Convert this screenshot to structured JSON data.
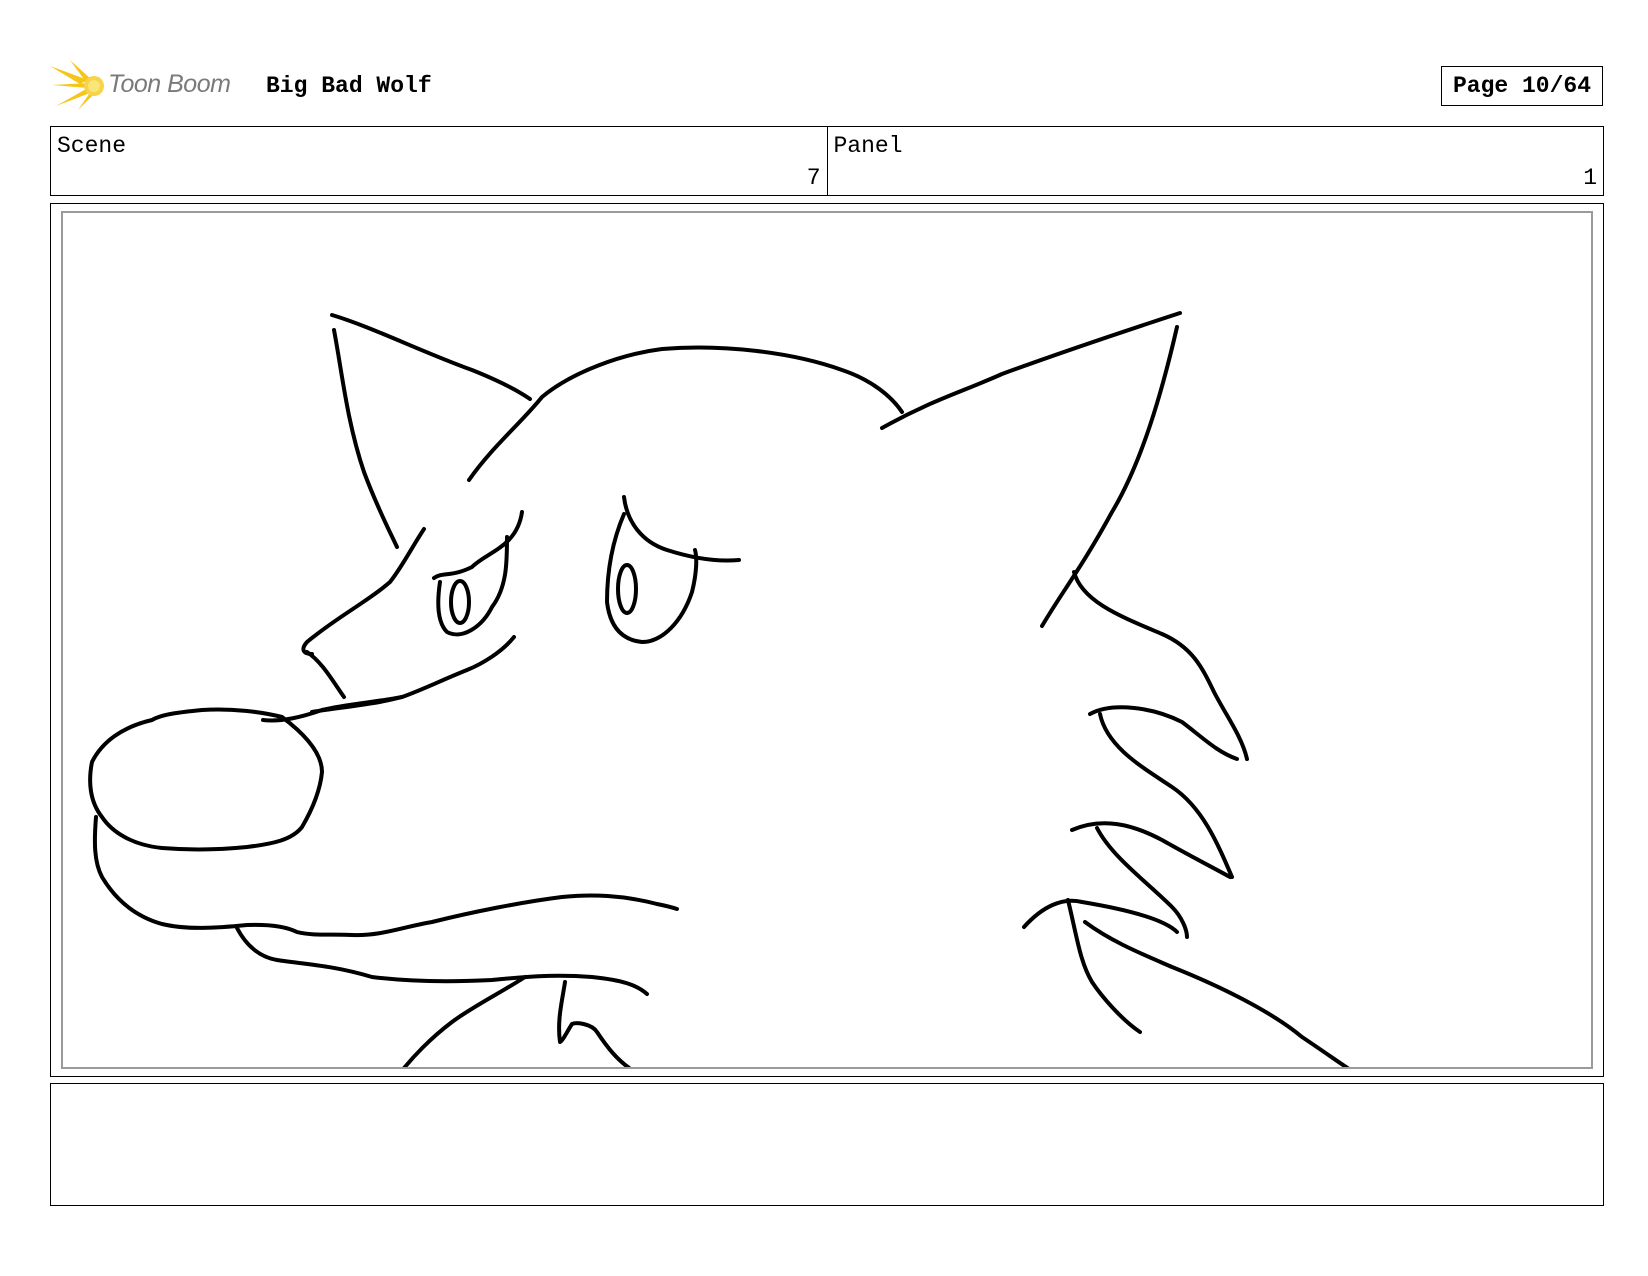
{
  "header": {
    "logo_text": "Toon Boom",
    "project_title": "Big Bad Wolf",
    "page_label": "Page 10/64"
  },
  "info": {
    "scene_label": "Scene",
    "scene_value": "7",
    "panel_label": "Panel",
    "panel_value": "1"
  },
  "drawing": {
    "subject": "wolf-head-sketch"
  },
  "notes": {
    "text": ""
  }
}
